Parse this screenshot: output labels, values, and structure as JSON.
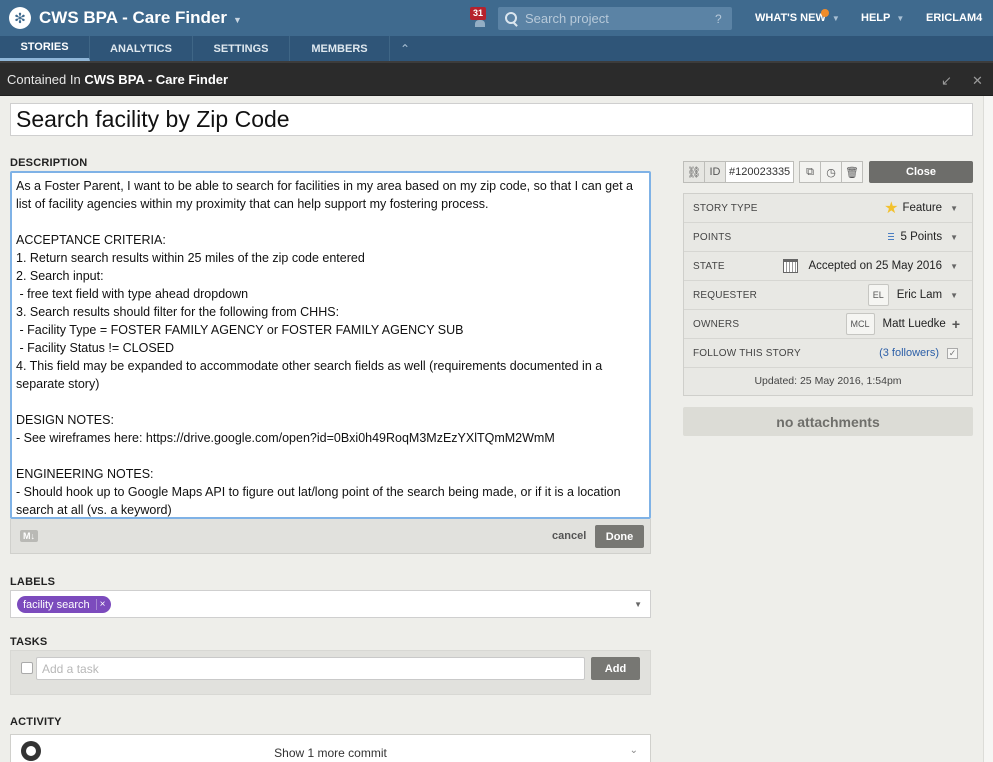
{
  "header": {
    "project_title": "CWS BPA - Care Finder",
    "notification_count": "31",
    "search_placeholder": "Search project",
    "search_help": "?",
    "whats_new": "WHAT'S NEW",
    "help": "HELP",
    "user": "ERICLAM4"
  },
  "nav": {
    "tabs": [
      {
        "label": "STORIES"
      },
      {
        "label": "ANALYTICS"
      },
      {
        "label": "SETTINGS"
      },
      {
        "label": "MEMBERS"
      }
    ],
    "collapse_icon": "double-chevron-up"
  },
  "contained": {
    "prefix": "Contained In",
    "project": "CWS BPA - Care Finder"
  },
  "story": {
    "title": "Search facility by Zip Code",
    "description_label": "DESCRIPTION",
    "description": "As a Foster Parent, I want to be able to search for facilities in my area based on my zip code, so that I can get a list of facility agencies within my proximity that can help support my fostering process.\n\nACCEPTANCE CRITERIA:\n1. Return search results within 25 miles of the zip code entered\n2. Search input:\n - free text field with type ahead dropdown\n3. Search results should filter for the following from CHHS:\n - Facility Type = FOSTER FAMILY AGENCY or FOSTER FAMILY AGENCY SUB\n - Facility Status != CLOSED\n4. This field may be expanded to accommodate other search fields as well (requirements documented in a separate story)\n\nDESIGN NOTES:\n- See wireframes here: https://drive.google.com/open?id=0Bxi0h49RoqM3MzEzYXlTQmM2WmM\n\nENGINEERING NOTES:\n- Should hook up to Google Maps API to figure out lat/long point of the search being made, or if it is a location search at all (vs. a keyword)",
    "markdown_badge": "M↓",
    "cancel": "cancel",
    "done": "Done",
    "labels_label": "LABELS",
    "labels": [
      {
        "text": "facility search",
        "color": "#7c4bbd"
      }
    ],
    "tasks_label": "TASKS",
    "task_placeholder": "Add a task",
    "add": "Add",
    "activity_label": "ACTIVITY",
    "show_commit": "Show 1 more commit"
  },
  "sidebar": {
    "id_label": "ID",
    "id_value": "#120023335",
    "close": "Close",
    "rows": {
      "story_type": {
        "label": "STORY TYPE",
        "value": "Feature"
      },
      "points": {
        "label": "POINTS",
        "value": "5 Points"
      },
      "state": {
        "label": "STATE",
        "value": "Accepted on 25 May 2016"
      },
      "requester": {
        "label": "REQUESTER",
        "initials": "EL",
        "value": "Eric Lam"
      },
      "owners": {
        "label": "OWNERS",
        "initials": "MCL",
        "value": "Matt Luedke"
      },
      "follow": {
        "label": "FOLLOW THIS STORY",
        "value": "(3 followers)"
      }
    },
    "updated": "Updated: 25 May 2016, 1:54pm",
    "attachments": "no attachments"
  },
  "colors": {
    "header_blue": "#3f6a8e",
    "nav_blue": "#2f5578",
    "label_purple": "#7c4bbd",
    "notification_red": "#b6222d",
    "star_yellow": "#f2c12e"
  }
}
